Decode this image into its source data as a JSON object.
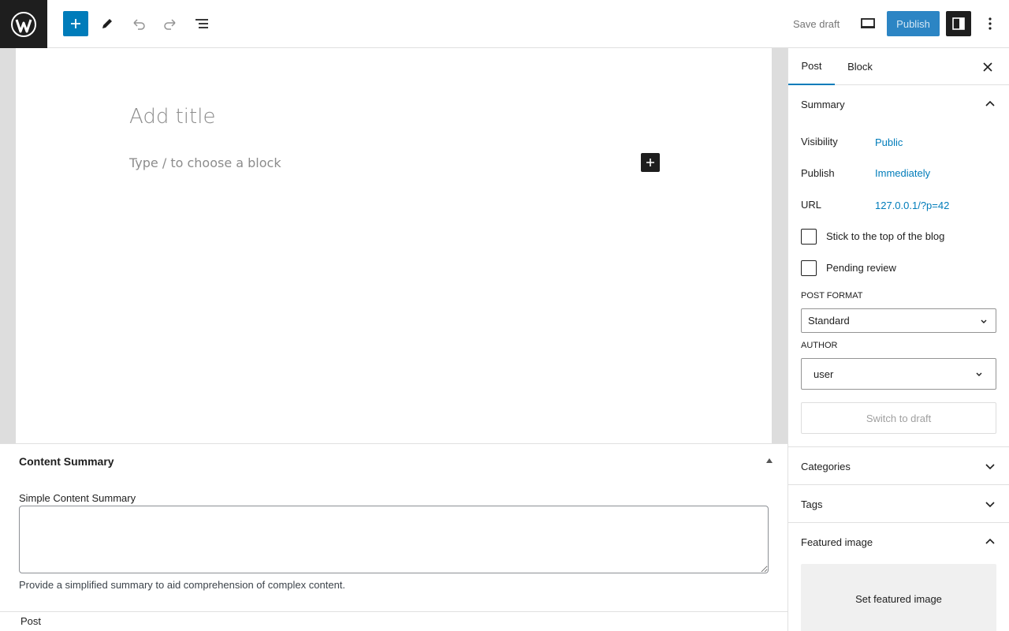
{
  "toolbar": {
    "logo_icon": "wordpress-logo",
    "add_block_icon": "plus-icon",
    "tools_icon": "pencil-icon",
    "undo_icon": "undo-icon",
    "redo_icon": "redo-icon",
    "document_overview_icon": "list-view-icon",
    "save_draft_label": "Save draft",
    "preview_icon": "desktop-icon",
    "publish_label": "Publish",
    "settings_icon": "sidebar-toggle-icon",
    "options_icon": "more-vertical-icon"
  },
  "editor": {
    "title_placeholder": "Add title",
    "block_placeholder": "Type / to choose a block",
    "block_add_icon": "plus-icon"
  },
  "metabox": {
    "title": "Content Summary",
    "field_label": "Simple Content Summary",
    "field_value": "",
    "help_text": "Provide a simplified summary to aid comprehension of complex content."
  },
  "footer": {
    "breadcrumb": "Post"
  },
  "sidebar": {
    "tabs": [
      {
        "label": "Post",
        "active": true
      },
      {
        "label": "Block",
        "active": false
      }
    ],
    "close_icon": "close-icon",
    "summary": {
      "title": "Summary",
      "expanded": true,
      "visibility_label": "Visibility",
      "visibility_value": "Public",
      "publish_label": "Publish",
      "publish_value": "Immediately",
      "url_label": "URL",
      "url_value": "127.0.0.1/?p=42",
      "sticky_label": "Stick to the top of the blog",
      "sticky_checked": false,
      "pending_label": "Pending review",
      "pending_checked": false,
      "post_format_label": "POST FORMAT",
      "post_format_value": "Standard",
      "author_label": "AUTHOR",
      "author_value": "user",
      "switch_draft_label": "Switch to draft"
    },
    "categories": {
      "title": "Categories",
      "expanded": false
    },
    "tags": {
      "title": "Tags",
      "expanded": false
    },
    "featured_image": {
      "title": "Featured image",
      "expanded": true,
      "button_label": "Set featured image"
    }
  },
  "colors": {
    "accent": "#007cba",
    "dark": "#1e1e1e",
    "border": "#e0e0e0"
  }
}
